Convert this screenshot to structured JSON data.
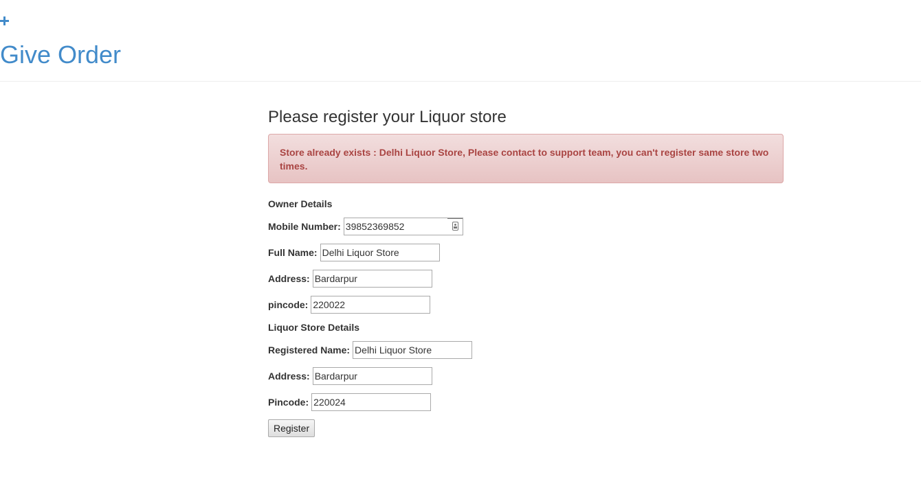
{
  "header": {
    "title": "Give Order"
  },
  "form": {
    "title": "Please register your Liquor store",
    "alert": "Store already exists : Delhi Liquor Store, Please contact to support team, you can't register same store two times.",
    "owner_section": "Owner Details",
    "mobile_label": "Mobile Number:",
    "mobile_value": "39852369852",
    "fullname_label": "Full Name:",
    "fullname_value": "Delhi Liquor Store",
    "owner_address_label": "Address:",
    "owner_address_value": "Bardarpur",
    "owner_pincode_label": "pincode:",
    "owner_pincode_value": "220022",
    "store_section": "Liquor Store Details",
    "regname_label": "Registered Name:",
    "regname_value": "Delhi Liquor Store",
    "store_address_label": "Address:",
    "store_address_value": "Bardarpur",
    "store_pincode_label": "Pincode:",
    "store_pincode_value": "220024",
    "register_button": "Register"
  },
  "colors": {
    "brand": "#428bca",
    "alert_text": "#a94442",
    "alert_bg": "#f2dede"
  },
  "icons": {
    "header_icon": "plus-icon",
    "mobile_field_icon": "contact-card-icon"
  }
}
